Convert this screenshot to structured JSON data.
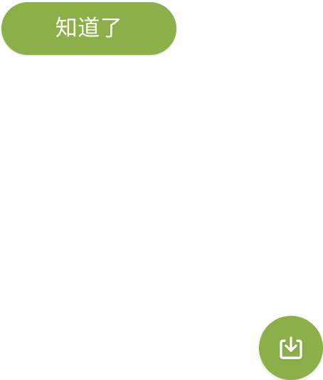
{
  "colors": {
    "accent": "#8BB04A",
    "icon": "#FFFFFF"
  },
  "dialog": {
    "button_label": "知道了"
  },
  "download": {
    "icon_name": "download-icon"
  }
}
